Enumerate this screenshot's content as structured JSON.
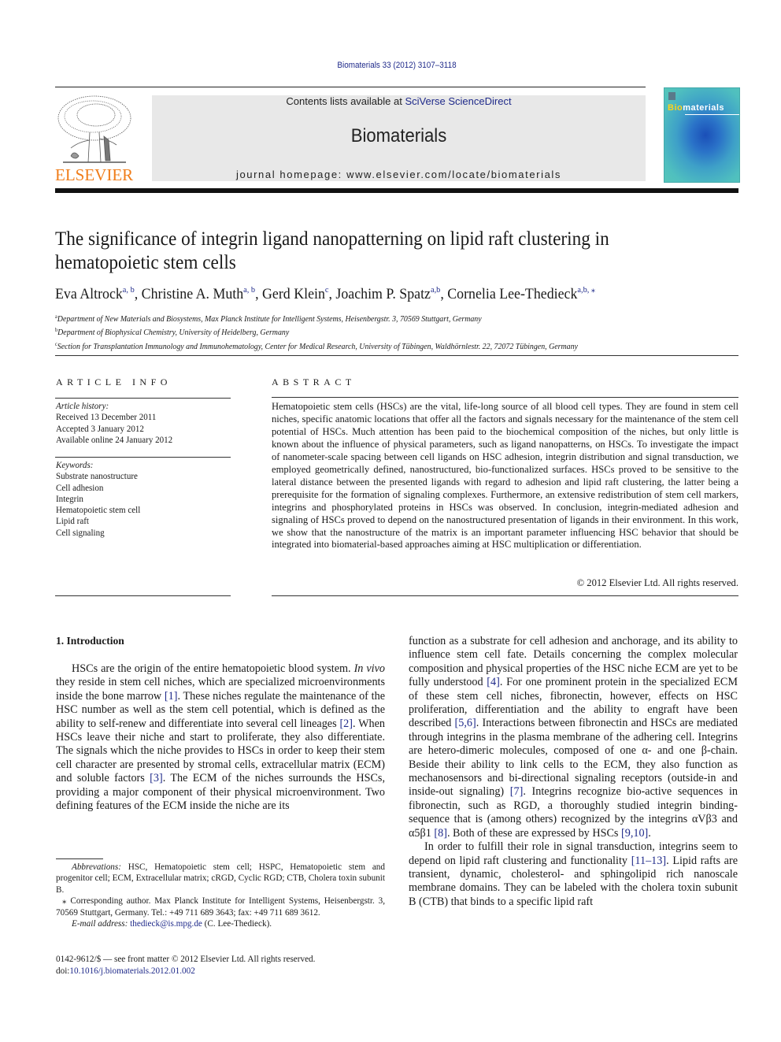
{
  "header": {
    "journal_reference": "Biomaterials 33 (2012) 3107–3118",
    "contents_prefix": "Contents lists available at ",
    "contents_link": "SciVerse ScienceDirect",
    "journal_name": "Biomaterials",
    "homepage": "journal homepage: www.elsevier.com/locate/biomaterials",
    "publisher_logo_text": "ELSEVIER",
    "publisher_logo_color": "#f07d1a",
    "cover": {
      "title_highlight": "Bio",
      "title_rest": "materials"
    },
    "link_color": "#1f2a8a"
  },
  "article": {
    "title": "The significance of integrin ligand nanopatterning on lipid raft clustering in hematopoietic stem cells",
    "authors": [
      {
        "name": "Eva Altrock",
        "aff": "a, b"
      },
      {
        "name": "Christine A. Muth",
        "aff": "a, b"
      },
      {
        "name": "Gerd Klein",
        "aff": "c"
      },
      {
        "name": "Joachim P. Spatz",
        "aff": "a,b"
      },
      {
        "name": "Cornelia Lee-Thedieck",
        "aff": "a,b, ⁎"
      }
    ],
    "affiliations": [
      {
        "key": "a",
        "text": "Department of New Materials and Biosystems, Max Planck Institute for Intelligent Systems, Heisenbergstr. 3, 70569 Stuttgart, Germany"
      },
      {
        "key": "b",
        "text": "Department of Biophysical Chemistry, University of Heidelberg, Germany"
      },
      {
        "key": "c",
        "text": "Section for Transplantation Immunology and Immunohematology, Center for Medical Research, University of Tübingen, Waldhörnlestr. 22, 72072 Tübingen, Germany"
      }
    ]
  },
  "article_info": {
    "heading": "ARTICLE INFO",
    "history_label": "Article history:",
    "history": [
      "Received 13 December 2011",
      "Accepted 3 January 2012",
      "Available online 24 January 2012"
    ],
    "keywords_label": "Keywords:",
    "keywords": [
      "Substrate nanostructure",
      "Cell adhesion",
      "Integrin",
      "Hematopoietic stem cell",
      "Lipid raft",
      "Cell signaling"
    ]
  },
  "abstract": {
    "heading": "ABSTRACT",
    "text": "Hematopoietic stem cells (HSCs) are the vital, life-long source of all blood cell types. They are found in stem cell niches, specific anatomic locations that offer all the factors and signals necessary for the maintenance of the stem cell potential of HSCs. Much attention has been paid to the biochemical composition of the niches, but only little is known about the influence of physical parameters, such as ligand nanopatterns, on HSCs. To investigate the impact of nanometer-scale spacing between cell ligands on HSC adhesion, integrin distribution and signal transduction, we employed geometrically defined, nanostructured, bio-functionalized surfaces. HSCs proved to be sensitive to the lateral distance between the presented ligands with regard to adhesion and lipid raft clustering, the latter being a prerequisite for the formation of signaling complexes. Furthermore, an extensive redistribution of stem cell markers, integrins and phosphorylated proteins in HSCs was observed. In conclusion, integrin-mediated adhesion and signaling of HSCs proved to depend on the nanostructured presentation of ligands in their environment. In this work, we show that the nanostructure of the matrix is an important parameter influencing HSC behavior that should be integrated into biomaterial-based approaches aiming at HSC multiplication or differentiation.",
    "copyright": "© 2012 Elsevier Ltd. All rights reserved."
  },
  "intro": {
    "heading": "1.  Introduction",
    "left": {
      "p1": [
        {
          "t": "HSCs are the origin of the entire hematopoietic blood system. "
        },
        {
          "t": "In vivo",
          "i": true
        },
        {
          "t": " they reside in stem cell niches, which are specialized microenvironments inside the bone marrow "
        },
        {
          "t": "[1]",
          "ref": true
        },
        {
          "t": ". These niches regulate the maintenance of the HSC number as well as the stem cell potential, which is defined as the ability to self-renew and differentiate into several cell lineages "
        },
        {
          "t": "[2]",
          "ref": true
        },
        {
          "t": ". When HSCs leave their niche and start to proliferate, they also differentiate. The signals which the niche provides to HSCs in order to keep their stem cell character are presented by stromal cells, extracellular matrix (ECM) and soluble factors "
        },
        {
          "t": "[3]",
          "ref": true
        },
        {
          "t": ". The ECM of the niches surrounds the HSCs, providing a major component of their physical microenvironment. Two defining features of the ECM inside the niche are its"
        }
      ]
    },
    "right": {
      "p1": [
        {
          "t": "function as a substrate for cell adhesion and anchorage, and its ability to influence stem cell fate. Details concerning the complex molecular composition and physical properties of the HSC niche ECM are yet to be fully understood "
        },
        {
          "t": "[4]",
          "ref": true
        },
        {
          "t": ". For one prominent protein in the specialized ECM of these stem cell niches, fibronectin, however, effects on HSC proliferation, differentiation and the ability to engraft have been described "
        },
        {
          "t": "[5,6]",
          "ref": true
        },
        {
          "t": ". Interactions between fibronectin and HSCs are mediated through integrins in the plasma membrane of the adhering cell. Integrins are hetero-dimeric molecules, composed of one α- and one β-chain. Beside their ability to link cells to the ECM, they also function as mechanosensors and bi-directional signaling receptors (outside-in and inside-out signaling) "
        },
        {
          "t": "[7]",
          "ref": true
        },
        {
          "t": ". Integrins recognize bio-active sequences in fibronectin, such as RGD, a thoroughly studied integrin binding-sequence that is (among others) recognized by the integrins αVβ3 and α5β1 "
        },
        {
          "t": "[8]",
          "ref": true
        },
        {
          "t": ". Both of these are expressed by HSCs "
        },
        {
          "t": "[9,10]",
          "ref": true
        },
        {
          "t": "."
        }
      ],
      "p2": [
        {
          "t": "In order to fulfill their role in signal transduction, integrins seem to depend on lipid raft clustering and functionality "
        },
        {
          "t": "[11–13]",
          "ref": true
        },
        {
          "t": ". Lipid rafts are transient, dynamic, cholesterol- and sphingolipid rich nanoscale membrane domains. They can be labeled with the cholera toxin subunit B (CTB) that binds to a specific lipid raft"
        }
      ]
    }
  },
  "footnotes": {
    "abbrev_label": "Abbrevations:",
    "abbrev_text": " HSC, Hematopoietic stem cell; HSPC, Hematopoietic stem and progenitor cell; ECM, Extracellular matrix; cRGD, Cyclic RGD; CTB, Cholera toxin subunit B.",
    "corresponding": "⁎ Corresponding author. Max Planck Institute for Intelligent Systems, Heisenbergstr. 3, 70569 Stuttgart, Germany. Tel.: +49 711 689 3643; fax: +49 711 689 3612.",
    "email_label": "E-mail address:",
    "email": "thedieck@is.mpg.de",
    "email_suffix": " (C. Lee-Thedieck).",
    "issn_line": "0142-9612/$ — see front matter © 2012 Elsevier Ltd. All rights reserved.",
    "doi_prefix": "doi:",
    "doi": "10.1016/j.biomaterials.2012.01.002"
  }
}
